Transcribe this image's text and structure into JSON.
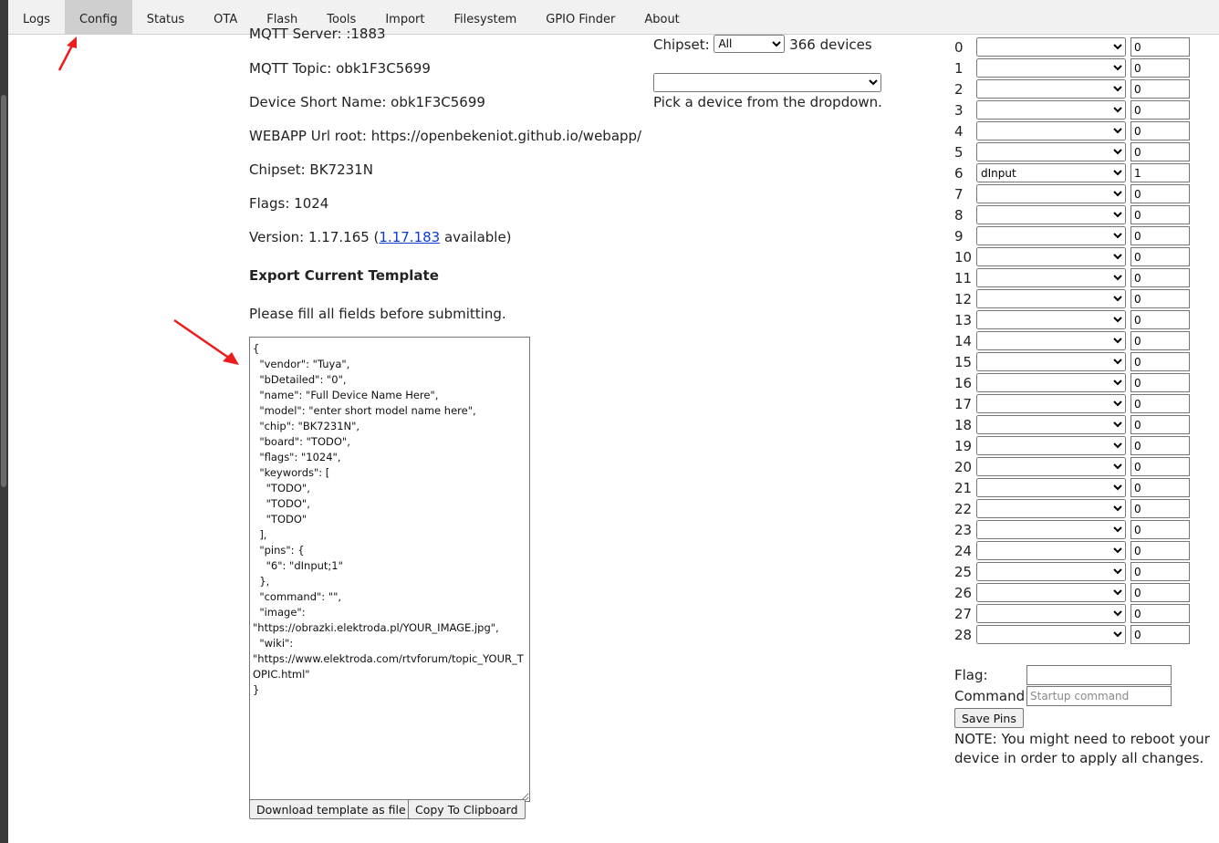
{
  "tabs": [
    "Logs",
    "Config",
    "Status",
    "OTA",
    "Flash",
    "Tools",
    "Import",
    "Filesystem",
    "GPIO Finder",
    "About"
  ],
  "active_tab": "Config",
  "info": {
    "mqtt_server_partial": "MQTT Server: :1883",
    "mqtt_topic": "MQTT Topic: obk1F3C5699",
    "short_name": "Device Short Name: obk1F3C5699",
    "webapp_root": "WEBAPP Url root: https://openbekeniot.github.io/webapp/",
    "chipset": "Chipset: BK7231N",
    "flags": "Flags: 1024",
    "version_prefix": "Version: 1.17.165 (",
    "version_link": "1.17.183",
    "version_suffix": " available)"
  },
  "export": {
    "heading": "Export Current Template",
    "hint": "Please fill all fields before submitting.",
    "template_text": "{\n  \"vendor\": \"Tuya\",\n  \"bDetailed\": \"0\",\n  \"name\": \"Full Device Name Here\",\n  \"model\": \"enter short model name here\",\n  \"chip\": \"BK7231N\",\n  \"board\": \"TODO\",\n  \"flags\": \"1024\",\n  \"keywords\": [\n    \"TODO\",\n    \"TODO\",\n    \"TODO\"\n  ],\n  \"pins\": {\n    \"6\": \"dInput;1\"\n  },\n  \"command\": \"\",\n  \"image\": \"https://obrazki.elektroda.pl/YOUR_IMAGE.jpg\",\n  \"wiki\": \"https://www.elektroda.com/rtvforum/topic_YOUR_TOPIC.html\"\n}",
    "download_label": "Download template as file",
    "copy_label": "Copy To Clipboard"
  },
  "device_picker": {
    "chipset_label": "Chipset:",
    "chipset_selected": "All",
    "device_count": "366 devices",
    "device_selected": "",
    "hint": "Pick a device from the dropdown."
  },
  "pins": [
    {
      "num": "0",
      "role": "",
      "value": "0"
    },
    {
      "num": "1",
      "role": "",
      "value": "0"
    },
    {
      "num": "2",
      "role": "",
      "value": "0"
    },
    {
      "num": "3",
      "role": "",
      "value": "0"
    },
    {
      "num": "4",
      "role": "",
      "value": "0"
    },
    {
      "num": "5",
      "role": "",
      "value": "0"
    },
    {
      "num": "6",
      "role": "dInput",
      "value": "1"
    },
    {
      "num": "7",
      "role": "",
      "value": "0"
    },
    {
      "num": "8",
      "role": "",
      "value": "0"
    },
    {
      "num": "9",
      "role": "",
      "value": "0"
    },
    {
      "num": "10",
      "role": "",
      "value": "0"
    },
    {
      "num": "11",
      "role": "",
      "value": "0"
    },
    {
      "num": "12",
      "role": "",
      "value": "0"
    },
    {
      "num": "13",
      "role": "",
      "value": "0"
    },
    {
      "num": "14",
      "role": "",
      "value": "0"
    },
    {
      "num": "15",
      "role": "",
      "value": "0"
    },
    {
      "num": "16",
      "role": "",
      "value": "0"
    },
    {
      "num": "17",
      "role": "",
      "value": "0"
    },
    {
      "num": "18",
      "role": "",
      "value": "0"
    },
    {
      "num": "19",
      "role": "",
      "value": "0"
    },
    {
      "num": "20",
      "role": "",
      "value": "0"
    },
    {
      "num": "21",
      "role": "",
      "value": "0"
    },
    {
      "num": "22",
      "role": "",
      "value": "0"
    },
    {
      "num": "23",
      "role": "",
      "value": "0"
    },
    {
      "num": "24",
      "role": "",
      "value": "0"
    },
    {
      "num": "25",
      "role": "",
      "value": "0"
    },
    {
      "num": "26",
      "role": "",
      "value": "0"
    },
    {
      "num": "27",
      "role": "",
      "value": "0"
    },
    {
      "num": "28",
      "role": "",
      "value": "0"
    }
  ],
  "pin_form": {
    "flag_label": "Flag:",
    "flag_value": "",
    "command_label": "Command:",
    "command_placeholder": "Startup command",
    "save_label": "Save Pins",
    "note": "NOTE: You might need to reboot your device in order to apply all changes."
  },
  "colors": {
    "annotation_arrow": "#ee1c1c",
    "active_tab_bg": "#cfcfcf",
    "link": "#0b3bd1"
  }
}
